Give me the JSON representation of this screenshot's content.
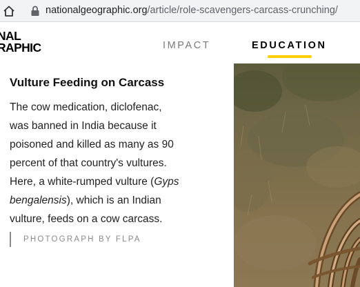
{
  "browser": {
    "url_domain": "nationalgeographic.org",
    "url_path": "/article/role-scavengers-carcass-crunching/"
  },
  "header": {
    "logo_line1": "NAL",
    "logo_line2": "RAPHIC",
    "nav": [
      {
        "label": "IMPACT",
        "active": false
      },
      {
        "label": "EDUCATION",
        "active": true
      }
    ],
    "accent_color": "#ffce00"
  },
  "caption": {
    "title": "Vulture Feeding on Carcass",
    "lines": [
      "The cow medication, diclofenac,",
      "was banned in India because it",
      "poisoned and killed as many as 90",
      "percent of that country's vultures.",
      "Here, a white-rumped vulture (",
      "Gyps",
      ")",
      "bengalensis",
      "), which is an Indian",
      "vulture, feeds on a cow carcass."
    ],
    "credit": "PHOTOGRAPH BY FLPA"
  },
  "photo": {
    "alt_name": "vulture-carcass-photo"
  }
}
